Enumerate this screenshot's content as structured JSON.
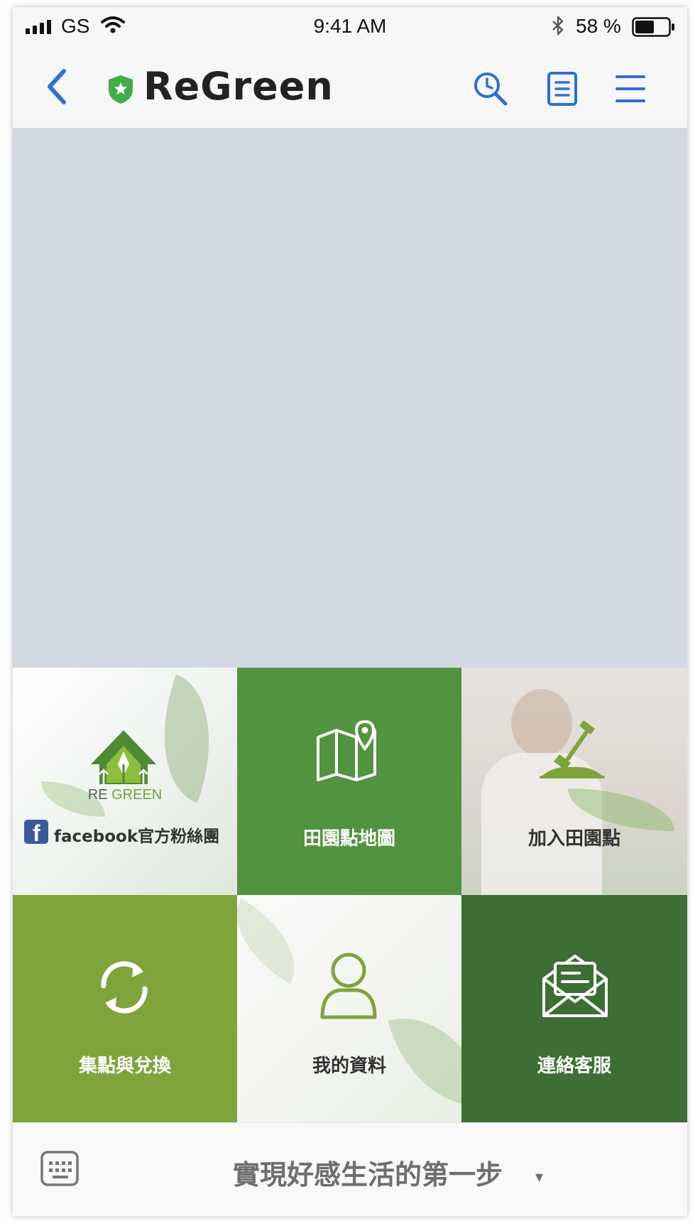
{
  "status_bar": {
    "carrier": "GS",
    "time": "9:41 AM",
    "battery": "58 %"
  },
  "nav": {
    "title": "ReGreen",
    "icons": [
      "back-icon",
      "shield-icon",
      "search-history-icon",
      "document-icon",
      "hamburger-menu-icon"
    ]
  },
  "tiles": [
    {
      "label": "facebook官方粉絲團",
      "icon": "facebook-icon",
      "logo_text": [
        "RE",
        "GREEN"
      ]
    },
    {
      "label": "田園點地圖",
      "icon": "map-pin-icon"
    },
    {
      "label": "加入田園點",
      "icon": "shovel-icon"
    },
    {
      "label": "集點與兌換",
      "icon": "refresh-icon"
    },
    {
      "label": "我的資料",
      "icon": "user-icon"
    },
    {
      "label": "連絡客服",
      "icon": "envelope-icon"
    }
  ],
  "bottom_bar": {
    "caption": "實現好感生活的第一步",
    "caret": "▾"
  },
  "colors": {
    "accent_blue": "#2f6fd6",
    "green_mid": "#529340",
    "green_olive": "#7fa43c",
    "green_dark": "#3d6e34",
    "banner_gray": "#d3d9e3"
  }
}
